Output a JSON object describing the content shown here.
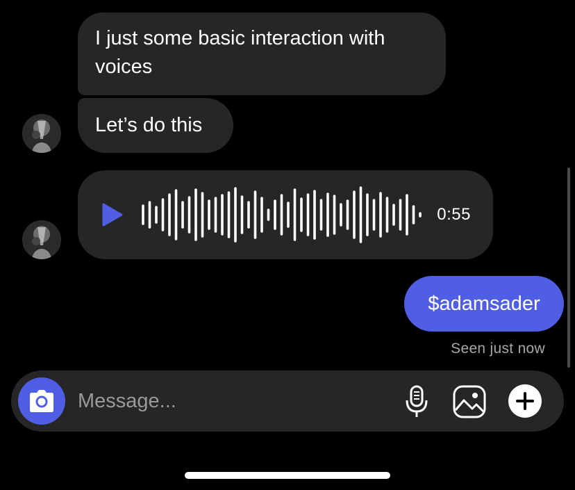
{
  "conversation": {
    "incoming_messages": [
      {
        "text": "I just some basic interaction with voices"
      },
      {
        "text": "Let’s do this"
      }
    ],
    "voice_message": {
      "duration": "0:55",
      "play_icon": "play-icon",
      "accent_color": "#4f5ee3"
    },
    "outgoing_message": {
      "text": "$adamsader",
      "bubble_color": "#4f5ee3"
    },
    "read_receipt": "Seen just now"
  },
  "composer": {
    "placeholder": "Message...",
    "camera_icon": "camera-icon",
    "mic_icon": "microphone-icon",
    "gallery_icon": "gallery-icon",
    "plus_icon": "plus-icon"
  },
  "colors": {
    "background": "#000000",
    "incoming_bubble": "#262626",
    "accent": "#4f5ee3",
    "muted_text": "#a8a8a8"
  }
}
